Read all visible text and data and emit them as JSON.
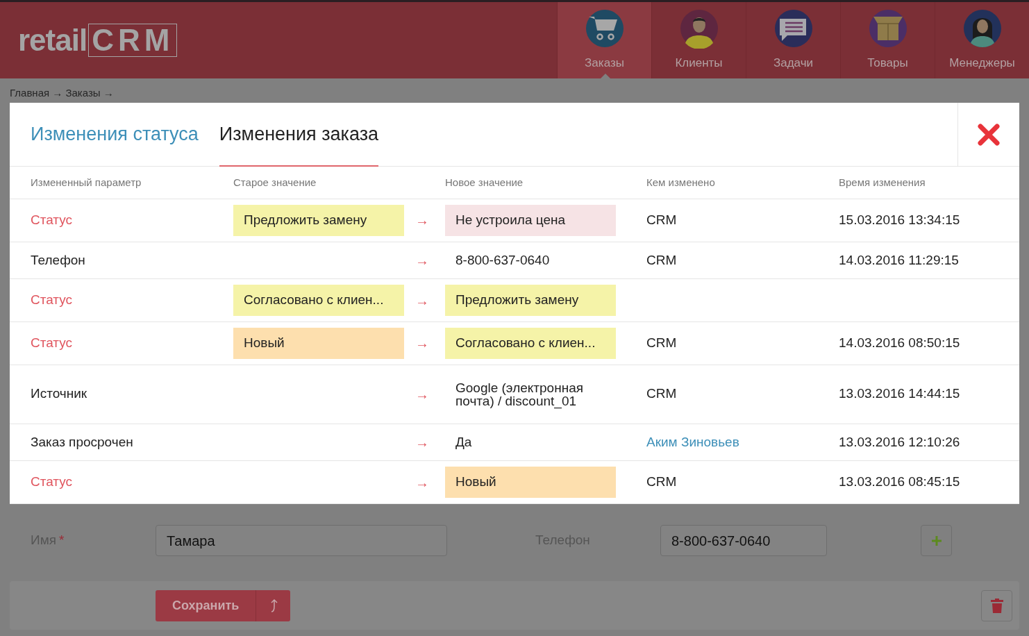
{
  "header": {
    "logo": {
      "text": "retail",
      "accent": "CRM"
    },
    "nav": [
      {
        "label": "Заказы",
        "selected": true,
        "kind": "cart"
      },
      {
        "label": "Клиенты",
        "selected": false,
        "kind": "man"
      },
      {
        "label": "Задачи",
        "selected": false,
        "kind": "chat"
      },
      {
        "label": "Товары",
        "selected": false,
        "kind": "box"
      },
      {
        "label": "Менеджеры",
        "selected": false,
        "kind": "woman"
      }
    ]
  },
  "breadcrumb": "Главная → Заказы →",
  "modal": {
    "tabs": [
      {
        "label": "Изменения статуса",
        "selected": false
      },
      {
        "label": "Изменения заказа",
        "selected": true
      }
    ],
    "columns": [
      "Измененный параметр",
      "Старое значение",
      "Новое значение",
      "Кем изменено",
      "Время изменения"
    ],
    "rows": [
      {
        "param": "Статус",
        "kind": "status",
        "old": {
          "text": "Предложить замену",
          "color": "#f5f3a8"
        },
        "arrow": "→",
        "new": {
          "text": "Не устроила цена",
          "color": "#f6e3e5"
        },
        "who": {
          "text": "CRM",
          "kind": "plain"
        },
        "time": "15.03.2016 13:34:15"
      },
      {
        "param": "Телефон",
        "kind": "field",
        "arrow": "→",
        "new": {
          "text": "8-800-637-0640"
        },
        "who": {
          "text": "CRM",
          "kind": "plain"
        },
        "time": "14.03.2016 11:29:15"
      },
      {
        "param": "Статус",
        "kind": "status",
        "old": {
          "text": "Согласовано с клиен...",
          "color": "#f5f3a8"
        },
        "arrow": "→",
        "new": {
          "text": "Предложить замену",
          "color": "#f5f3a8"
        }
      },
      {
        "param": "Статус",
        "kind": "status",
        "old": {
          "text": "Новый",
          "color": "#fddfae"
        },
        "arrow": "→",
        "new": {
          "text": "Согласовано с клиен...",
          "color": "#f5f3a8"
        },
        "who": {
          "text": "CRM",
          "kind": "plain"
        },
        "time": "14.03.2016 08:50:15"
      },
      {
        "param": "Источник",
        "kind": "field",
        "arrow": "→",
        "new": {
          "text": "Google (электронная почта) / discount_01"
        },
        "who": {
          "text": "CRM",
          "kind": "plain"
        },
        "time": "13.03.2016 14:44:15"
      },
      {
        "param": "Заказ просрочен",
        "kind": "field",
        "arrow": "→",
        "new": {
          "text": "Да"
        },
        "who": {
          "text": "Аким Зиновьев",
          "kind": "link"
        },
        "time": "13.03.2016 12:10:26"
      },
      {
        "param": "Статус",
        "kind": "status",
        "arrow": "→",
        "new": {
          "text": "Новый",
          "color": "#fddfae"
        },
        "who": {
          "text": "CRM",
          "kind": "plain"
        },
        "time": "13.03.2016 08:45:15"
      }
    ]
  },
  "form": {
    "fields": [
      {
        "label": "Имя",
        "required": true,
        "value": "Тамара"
      },
      {
        "label": "Телефон",
        "required": false,
        "value": "8-800-637-0640"
      }
    ],
    "required_mark": "*"
  },
  "footer": {
    "save": "Сохранить"
  }
}
